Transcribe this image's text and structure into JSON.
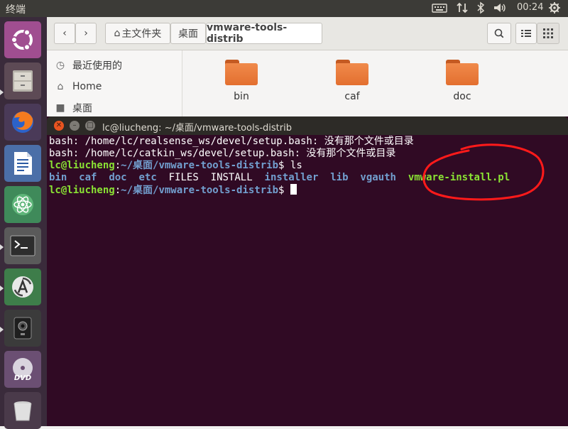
{
  "topbar": {
    "title": "终端",
    "clock": "00:24",
    "icons": [
      "keyboard-icon",
      "network-arrows-icon",
      "bluetooth-icon",
      "volume-icon",
      "power-gear-icon"
    ]
  },
  "launcher": {
    "items": [
      "ubuntu-logo-icon",
      "file-cabinet-icon",
      "firefox-icon",
      "writer-document-icon",
      "atom-icon",
      "terminal-icon",
      "software-updater-icon",
      "camera-app-icon",
      "dvd-icon",
      "trash-icon"
    ]
  },
  "files": {
    "breadcrumb": {
      "home": "主文件夹",
      "desktop": "桌面",
      "current": "vmware-tools-distrib"
    },
    "sidebar": {
      "recent": "最近使用的",
      "home": "Home",
      "desktop": "桌面"
    },
    "folders": [
      "bin",
      "caf",
      "doc"
    ]
  },
  "terminal": {
    "title": "lc@liucheng: ~/桌面/vmware-tools-distrib",
    "line1": "bash: /home/lc/realsense_ws/devel/setup.bash: 没有那个文件或目录",
    "line2": "bash: /home/lc/catkin_ws/devel/setup.bash: 没有那个文件或目录",
    "prompt_user": "lc@liucheng",
    "prompt_path": "~/桌面/vmware-tools-distrib",
    "cmd": "ls",
    "ls_items": [
      "bin",
      "caf",
      "doc",
      "etc",
      "FILES",
      "INSTALL",
      "installer",
      "lib",
      "vgauth",
      "vmware-install.pl"
    ]
  },
  "colors": {
    "terminal_bg": "#300a24",
    "prompt_green": "#8ae234",
    "dir_blue": "#729fcf",
    "annotation_red": "#ff1a1a",
    "folder_orange": "#e36f2f"
  }
}
